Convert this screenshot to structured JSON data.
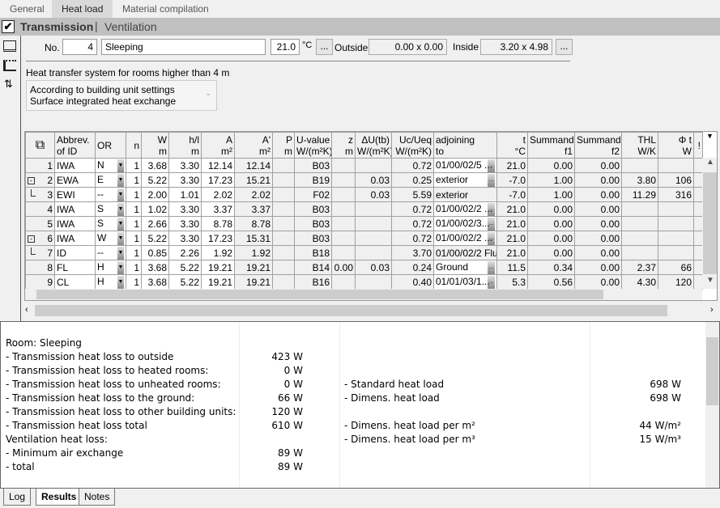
{
  "tabs": [
    "General",
    "Heat load",
    "Material compilation"
  ],
  "active_tab": "Heat load",
  "section": {
    "checked": true,
    "title": "Transmission",
    "separator": "|",
    "alt": "Ventilation"
  },
  "toolbar_icons": [
    "component-list-icon",
    "table-view-icon",
    "swap-icon"
  ],
  "room": {
    "no_label": "No.",
    "no": "4",
    "name": "Sleeping",
    "temp": "21.0",
    "temp_unit": "°C",
    "more": "...",
    "outside_label": "Outside",
    "outside": "0.00 x 0.00",
    "inside_label": "Inside",
    "inside": "3.20 x 4.98"
  },
  "heat_transfer": {
    "label": "Heat transfer system for rooms higher than 4 m",
    "line1": "According to building unit settings",
    "line2": "Surface integrated heat exchange"
  },
  "grid": {
    "headers": [
      [
        "",
        ""
      ],
      [
        "Abbrev.",
        "of ID"
      ],
      [
        "OR",
        ""
      ],
      [
        "n",
        ""
      ],
      [
        "W",
        "m"
      ],
      [
        "h/l",
        "m"
      ],
      [
        "A",
        "m²"
      ],
      [
        "A'",
        "m²"
      ],
      [
        "P",
        "m"
      ],
      [
        "U-value",
        "W/(m²K)"
      ],
      [
        "z",
        "m"
      ],
      [
        "ΔU(tb)",
        "W/(m²K)"
      ],
      [
        "Uc/Ueq",
        "W/(m²K)"
      ],
      [
        "adjoining",
        "to"
      ],
      [
        "t",
        "°C"
      ],
      [
        "Summand",
        "f1"
      ],
      [
        "Summand",
        "f2"
      ],
      [
        "THL",
        "W/K"
      ],
      [
        "Φ t",
        "W"
      ],
      [
        "!",
        ""
      ]
    ],
    "rows": [
      {
        "no": "1",
        "tree": "",
        "id": "IWA",
        "or": "N",
        "n": "1",
        "w": "3.68",
        "h": "3.30",
        "a": "12.14",
        "a2": "12.14",
        "p": "",
        "u": "B03",
        "z": "",
        "du": "",
        "uc": "0.72",
        "adj": "01/00/02/5 ...",
        "adj_btn": true,
        "t": "21.0",
        "f1": "0.00",
        "f2": "0.00",
        "thl": "",
        "phi": ""
      },
      {
        "no": "2",
        "tree": "minus",
        "id": "EWA",
        "or": "E",
        "n": "1",
        "w": "5.22",
        "h": "3.30",
        "a": "17.23",
        "a2": "15.21",
        "p": "",
        "u": "B19",
        "z": "",
        "du": "0.03",
        "uc": "0.25",
        "adj": "exterior",
        "adj_btn": true,
        "t": "-7.0",
        "f1": "1.00",
        "f2": "0.00",
        "thl": "3.80",
        "phi": "106"
      },
      {
        "no": "3",
        "tree": "end",
        "id": "EWI",
        "or": "--",
        "n": "1",
        "w": "2.00",
        "h": "1.01",
        "a": "2.02",
        "a2": "2.02",
        "p": "",
        "u": "F02",
        "z": "",
        "du": "0.03",
        "uc": "5.59",
        "adj": "exterior",
        "adj_btn": false,
        "t": "-7.0",
        "f1": "1.00",
        "f2": "0.00",
        "thl": "11.29",
        "phi": "316"
      },
      {
        "no": "4",
        "tree": "",
        "id": "IWA",
        "or": "S",
        "n": "1",
        "w": "1.02",
        "h": "3.30",
        "a": "3.37",
        "a2": "3.37",
        "p": "",
        "u": "B03",
        "z": "",
        "du": "",
        "uc": "0.72",
        "adj": "01/00/02/2 ...",
        "adj_btn": true,
        "t": "21.0",
        "f1": "0.00",
        "f2": "0.00",
        "thl": "",
        "phi": ""
      },
      {
        "no": "5",
        "tree": "",
        "id": "IWA",
        "or": "S",
        "n": "1",
        "w": "2.66",
        "h": "3.30",
        "a": "8.78",
        "a2": "8.78",
        "p": "",
        "u": "B03",
        "z": "",
        "du": "",
        "uc": "0.72",
        "adj": "01/00/02/3...",
        "adj_btn": true,
        "t": "21.0",
        "f1": "0.00",
        "f2": "0.00",
        "thl": "",
        "phi": ""
      },
      {
        "no": "6",
        "tree": "minus",
        "id": "IWA",
        "or": "W",
        "n": "1",
        "w": "5.22",
        "h": "3.30",
        "a": "17.23",
        "a2": "15.31",
        "p": "",
        "u": "B03",
        "z": "",
        "du": "",
        "uc": "0.72",
        "adj": "01/00/02/2 ...",
        "adj_btn": true,
        "t": "21.0",
        "f1": "0.00",
        "f2": "0.00",
        "thl": "",
        "phi": ""
      },
      {
        "no": "7",
        "tree": "end",
        "id": "ID",
        "or": "--",
        "n": "1",
        "w": "0.85",
        "h": "2.26",
        "a": "1.92",
        "a2": "1.92",
        "p": "",
        "u": "B18",
        "z": "",
        "du": "",
        "uc": "3.70",
        "adj": "01/00/02/2 Flur",
        "adj_btn": false,
        "t": "21.0",
        "f1": "0.00",
        "f2": "0.00",
        "thl": "",
        "phi": ""
      },
      {
        "no": "8",
        "tree": "",
        "id": "FL",
        "or": "H",
        "n": "1",
        "w": "3.68",
        "h": "5.22",
        "a": "19.21",
        "a2": "19.21",
        "p": "",
        "u": "B14",
        "z": "0.00",
        "du": "0.03",
        "uc": "0.24",
        "adj": "Ground",
        "adj_btn": true,
        "t": "11.5",
        "f1": "0.34",
        "f2": "0.00",
        "thl": "2.37",
        "phi": "66"
      },
      {
        "no": "9",
        "tree": "",
        "id": "CL",
        "or": "H",
        "n": "1",
        "w": "3.68",
        "h": "5.22",
        "a": "19.21",
        "a2": "19.21",
        "p": "",
        "u": "B16",
        "z": "",
        "du": "",
        "uc": "0.40",
        "adj": "01/01/03/1...",
        "adj_btn": true,
        "t": "5.3",
        "f1": "0.56",
        "f2": "0.00",
        "thl": "4.30",
        "phi": "120"
      }
    ]
  },
  "results": {
    "room": "Room: Sleeping",
    "left": [
      [
        "- Transmission heat loss to outside",
        "423 W"
      ],
      [
        "- Transmission heat loss to heated rooms:",
        "0 W"
      ],
      [
        "- Transmission heat loss to unheated rooms:",
        "0 W"
      ],
      [
        "- Transmission heat loss to the ground:",
        "66 W"
      ],
      [
        "- Transmission heat loss to other building units:",
        "120 W"
      ],
      [
        "- Transmission heat loss total",
        "610 W"
      ],
      [
        "Ventilation heat loss:",
        ""
      ],
      [
        "- Minimum air exchange",
        "89 W"
      ],
      [
        "- total",
        "89 W"
      ]
    ],
    "right": [
      [
        "- Standard heat load",
        "698 W"
      ],
      [
        "- Dimens. heat load",
        "698 W"
      ],
      [
        "",
        ""
      ],
      [
        "- Dimens. heat load per m²",
        "44 W/m²"
      ],
      [
        "- Dimens. heat load per m³",
        "15 W/m³"
      ]
    ]
  },
  "bottom_tabs": [
    "Log",
    "Results",
    "Notes"
  ],
  "active_bottom_tab": "Results"
}
